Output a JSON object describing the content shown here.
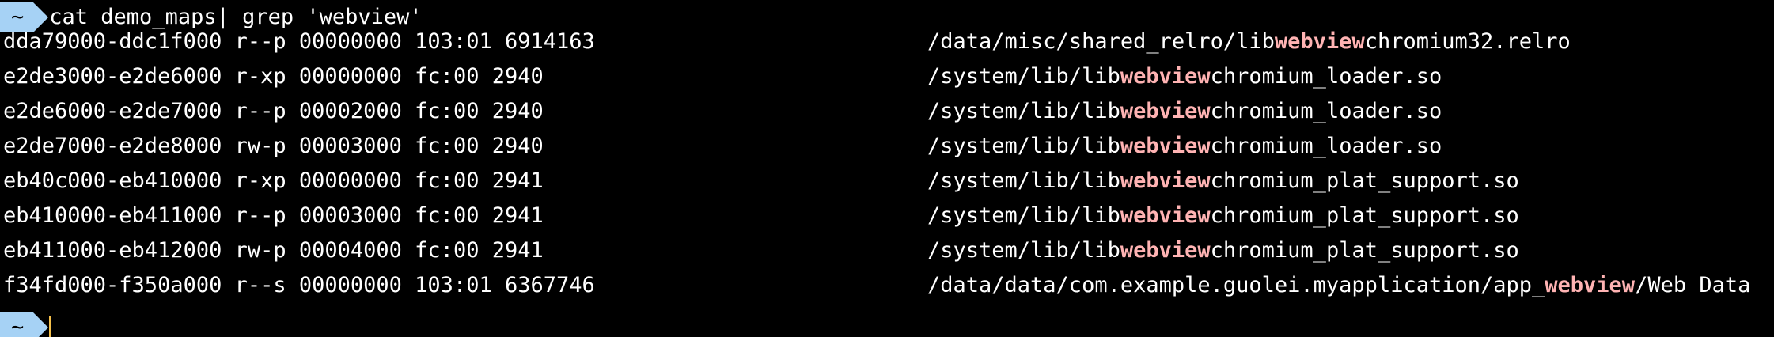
{
  "prompt": {
    "badge": "~",
    "command": "cat demo_maps| grep 'webview'"
  },
  "highlight": "webview",
  "output_rows": [
    {
      "addr": "dda79000-ddc1f000 r--p 00000000 103:01 6914163",
      "path_pre": "/data/misc/shared_relro/lib",
      "path_post": "chromium32.relro"
    },
    {
      "addr": "e2de3000-e2de6000 r-xp 00000000 fc:00 2940",
      "path_pre": "/system/lib/lib",
      "path_post": "chromium_loader.so"
    },
    {
      "addr": "e2de6000-e2de7000 r--p 00002000 fc:00 2940",
      "path_pre": "/system/lib/lib",
      "path_post": "chromium_loader.so"
    },
    {
      "addr": "e2de7000-e2de8000 rw-p 00003000 fc:00 2940",
      "path_pre": "/system/lib/lib",
      "path_post": "chromium_loader.so"
    },
    {
      "addr": "eb40c000-eb410000 r-xp 00000000 fc:00 2941",
      "path_pre": "/system/lib/lib",
      "path_post": "chromium_plat_support.so"
    },
    {
      "addr": "eb410000-eb411000 r--p 00003000 fc:00 2941",
      "path_pre": "/system/lib/lib",
      "path_post": "chromium_plat_support.so"
    },
    {
      "addr": "eb411000-eb412000 rw-p 00004000 fc:00 2941",
      "path_pre": "/system/lib/lib",
      "path_post": "chromium_plat_support.so"
    },
    {
      "addr": "f34fd000-f350a000 r--s 00000000 103:01 6367746",
      "path_pre": "/data/data/com.example.guolei.myapplication/app_",
      "path_post": "/Web Data"
    }
  ],
  "colors": {
    "background": "#000000",
    "text": "#ffffff",
    "prompt_badge": "#a6d2f5",
    "match_highlight": "#ffb3b3",
    "cursor": "#f5c04a"
  }
}
